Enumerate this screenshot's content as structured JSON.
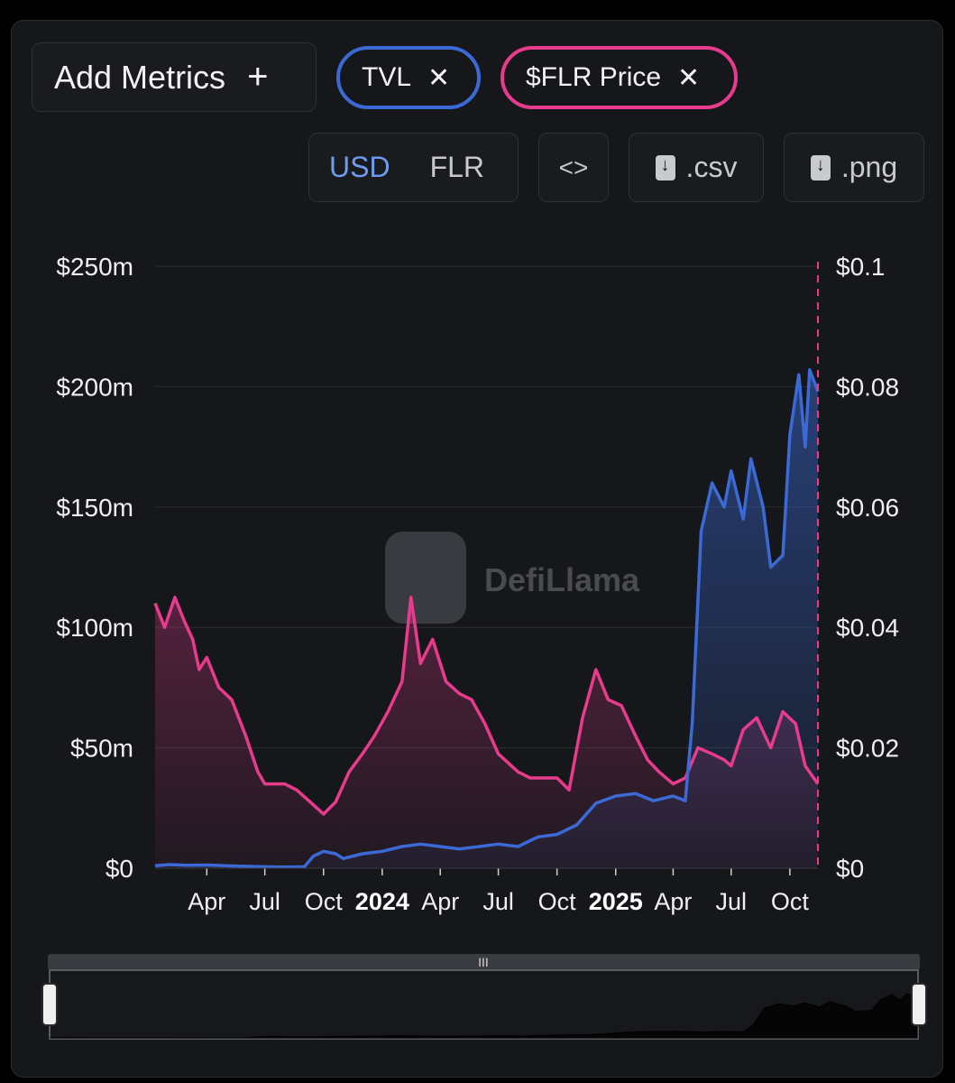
{
  "toolbar": {
    "add_metrics_label": "Add Metrics",
    "add_icon": "+",
    "tags": [
      {
        "label": "TVL",
        "color": "#3b6ad6"
      },
      {
        "label": "$FLR Price",
        "color": "#e83b8d"
      }
    ],
    "close_icon": "✕",
    "currency_options": [
      "USD",
      "FLR"
    ],
    "currency_selected": "USD",
    "embed_icon": "<>",
    "csv_label": ".csv",
    "png_label": ".png"
  },
  "watermark": "DefiLlama",
  "colors": {
    "accent_selected": "#6e9df0",
    "tvl": "#3b6ad6",
    "price": "#e83b8d",
    "grid": "#2c2d31"
  },
  "chart_data": {
    "type": "line",
    "left_ticks": [
      "$250m",
      "$200m",
      "$150m",
      "$100m",
      "$50m",
      "$0"
    ],
    "right_ticks": [
      "$0.1",
      "$0.08",
      "$0.06",
      "$0.04",
      "$0.02",
      "$0"
    ],
    "x_ticks": [
      {
        "label": "Apr",
        "date": "2023-04-01",
        "bold": false
      },
      {
        "label": "Jul",
        "date": "2023-07-01",
        "bold": false
      },
      {
        "label": "Oct",
        "date": "2023-10-01",
        "bold": false
      },
      {
        "label": "2024",
        "date": "2024-01-01",
        "bold": true
      },
      {
        "label": "Apr",
        "date": "2024-04-01",
        "bold": false
      },
      {
        "label": "Jul",
        "date": "2024-07-01",
        "bold": false
      },
      {
        "label": "Oct",
        "date": "2024-10-01",
        "bold": false
      },
      {
        "label": "2025",
        "date": "2025-01-01",
        "bold": true
      },
      {
        "label": "Apr",
        "date": "2025-04-01",
        "bold": false
      },
      {
        "label": "Jul",
        "date": "2025-07-01",
        "bold": false
      },
      {
        "label": "Oct",
        "date": "2025-10-01",
        "bold": false
      }
    ],
    "x_range": [
      "2023-01-10",
      "2025-11-14"
    ],
    "left_range": [
      0,
      250
    ],
    "left_unit": "m USD",
    "right_range": [
      0,
      0.1
    ],
    "grid": true,
    "series": [
      {
        "name": "TVL",
        "axis": "left",
        "color": "#3b6ad6",
        "points": [
          [
            "2023-01-10",
            1
          ],
          [
            "2023-02-01",
            1.5
          ],
          [
            "2023-03-01",
            1.2
          ],
          [
            "2023-04-01",
            1.3
          ],
          [
            "2023-05-01",
            1
          ],
          [
            "2023-06-01",
            0.8
          ],
          [
            "2023-07-01",
            0.6
          ],
          [
            "2023-08-01",
            0.5
          ],
          [
            "2023-09-01",
            0.6
          ],
          [
            "2023-09-15",
            5
          ],
          [
            "2023-10-01",
            7
          ],
          [
            "2023-10-20",
            6
          ],
          [
            "2023-11-01",
            4
          ],
          [
            "2023-12-01",
            6
          ],
          [
            "2024-01-01",
            7
          ],
          [
            "2024-02-01",
            9
          ],
          [
            "2024-03-01",
            10
          ],
          [
            "2024-04-01",
            9
          ],
          [
            "2024-05-01",
            8
          ],
          [
            "2024-06-01",
            9
          ],
          [
            "2024-07-01",
            10
          ],
          [
            "2024-08-01",
            9
          ],
          [
            "2024-09-01",
            13
          ],
          [
            "2024-10-01",
            14
          ],
          [
            "2024-11-01",
            18
          ],
          [
            "2024-12-01",
            27
          ],
          [
            "2025-01-01",
            30
          ],
          [
            "2025-02-01",
            31
          ],
          [
            "2025-03-01",
            28
          ],
          [
            "2025-04-01",
            30
          ],
          [
            "2025-04-20",
            28
          ],
          [
            "2025-05-01",
            60
          ],
          [
            "2025-05-15",
            140
          ],
          [
            "2025-06-01",
            160
          ],
          [
            "2025-06-20",
            150
          ],
          [
            "2025-07-01",
            165
          ],
          [
            "2025-07-20",
            145
          ],
          [
            "2025-08-01",
            170
          ],
          [
            "2025-08-20",
            150
          ],
          [
            "2025-09-01",
            125
          ],
          [
            "2025-09-20",
            130
          ],
          [
            "2025-10-01",
            180
          ],
          [
            "2025-10-15",
            205
          ],
          [
            "2025-10-25",
            175
          ],
          [
            "2025-11-01",
            207
          ],
          [
            "2025-11-14",
            198
          ]
        ]
      },
      {
        "name": "$FLR Price",
        "axis": "right",
        "color": "#e83b8d",
        "points": [
          [
            "2023-01-10",
            0.044
          ],
          [
            "2023-01-25",
            0.04
          ],
          [
            "2023-02-10",
            0.045
          ],
          [
            "2023-02-25",
            0.041
          ],
          [
            "2023-03-10",
            0.038
          ],
          [
            "2023-03-20",
            0.033
          ],
          [
            "2023-04-01",
            0.035
          ],
          [
            "2023-04-20",
            0.03
          ],
          [
            "2023-05-10",
            0.028
          ],
          [
            "2023-06-01",
            0.022
          ],
          [
            "2023-06-20",
            0.016
          ],
          [
            "2023-07-01",
            0.014
          ],
          [
            "2023-08-01",
            0.014
          ],
          [
            "2023-08-20",
            0.013
          ],
          [
            "2023-09-10",
            0.011
          ],
          [
            "2023-10-01",
            0.009
          ],
          [
            "2023-10-20",
            0.011
          ],
          [
            "2023-11-10",
            0.016
          ],
          [
            "2023-12-01",
            0.019
          ],
          [
            "2023-12-20",
            0.022
          ],
          [
            "2024-01-10",
            0.026
          ],
          [
            "2024-02-01",
            0.031
          ],
          [
            "2024-02-15",
            0.045
          ],
          [
            "2024-03-01",
            0.034
          ],
          [
            "2024-03-20",
            0.038
          ],
          [
            "2024-04-10",
            0.031
          ],
          [
            "2024-05-01",
            0.029
          ],
          [
            "2024-05-20",
            0.028
          ],
          [
            "2024-06-10",
            0.024
          ],
          [
            "2024-07-01",
            0.019
          ],
          [
            "2024-08-01",
            0.016
          ],
          [
            "2024-08-20",
            0.015
          ],
          [
            "2024-09-10",
            0.015
          ],
          [
            "2024-10-01",
            0.015
          ],
          [
            "2024-10-20",
            0.013
          ],
          [
            "2024-11-10",
            0.025
          ],
          [
            "2024-12-01",
            0.033
          ],
          [
            "2024-12-20",
            0.028
          ],
          [
            "2025-01-10",
            0.027
          ],
          [
            "2025-02-01",
            0.022
          ],
          [
            "2025-02-20",
            0.018
          ],
          [
            "2025-03-10",
            0.016
          ],
          [
            "2025-04-01",
            0.014
          ],
          [
            "2025-04-20",
            0.015
          ],
          [
            "2025-05-10",
            0.02
          ],
          [
            "2025-06-01",
            0.019
          ],
          [
            "2025-06-20",
            0.018
          ],
          [
            "2025-07-01",
            0.017
          ],
          [
            "2025-07-20",
            0.023
          ],
          [
            "2025-08-10",
            0.025
          ],
          [
            "2025-09-01",
            0.02
          ],
          [
            "2025-09-20",
            0.026
          ],
          [
            "2025-10-10",
            0.024
          ],
          [
            "2025-10-25",
            0.017
          ],
          [
            "2025-11-14",
            0.014
          ]
        ]
      }
    ]
  }
}
